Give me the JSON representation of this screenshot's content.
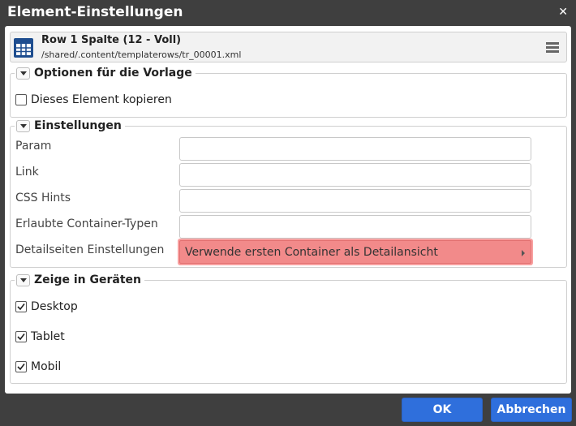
{
  "dialog": {
    "title": "Element-Einstellungen",
    "close_icon": "close-icon"
  },
  "resource": {
    "icon": "grid-table-icon",
    "title": "Row 1 Spalte (12 - Voll)",
    "path": "/shared/.content/templaterows/tr_00001.xml",
    "menu_icon": "hamburger-menu-icon"
  },
  "sections": {
    "template_options": {
      "legend": "Optionen für die Vorlage",
      "copy_element": {
        "label": "Dieses Element kopieren",
        "checked": false
      }
    },
    "settings": {
      "legend": "Einstellungen",
      "fields": [
        {
          "label": "Param",
          "value": ""
        },
        {
          "label": "Link",
          "value": ""
        },
        {
          "label": "CSS Hints",
          "value": ""
        },
        {
          "label": "Erlaubte Container-Typen",
          "value": ""
        }
      ],
      "detail_settings": {
        "label": "Detailseiten Einstellungen",
        "selected": "Verwende ersten Container als Detailansicht"
      }
    },
    "devices": {
      "legend": "Zeige in Geräten",
      "items": [
        {
          "label": "Desktop",
          "checked": true
        },
        {
          "label": "Tablet",
          "checked": true
        },
        {
          "label": "Mobil",
          "checked": true
        }
      ]
    }
  },
  "buttons": {
    "ok": "OK",
    "cancel": "Abbrechen"
  },
  "colors": {
    "primary_button": "#2f6fdc",
    "highlight_select": "#f28a8a",
    "titlebar": "#3f3f3f"
  }
}
